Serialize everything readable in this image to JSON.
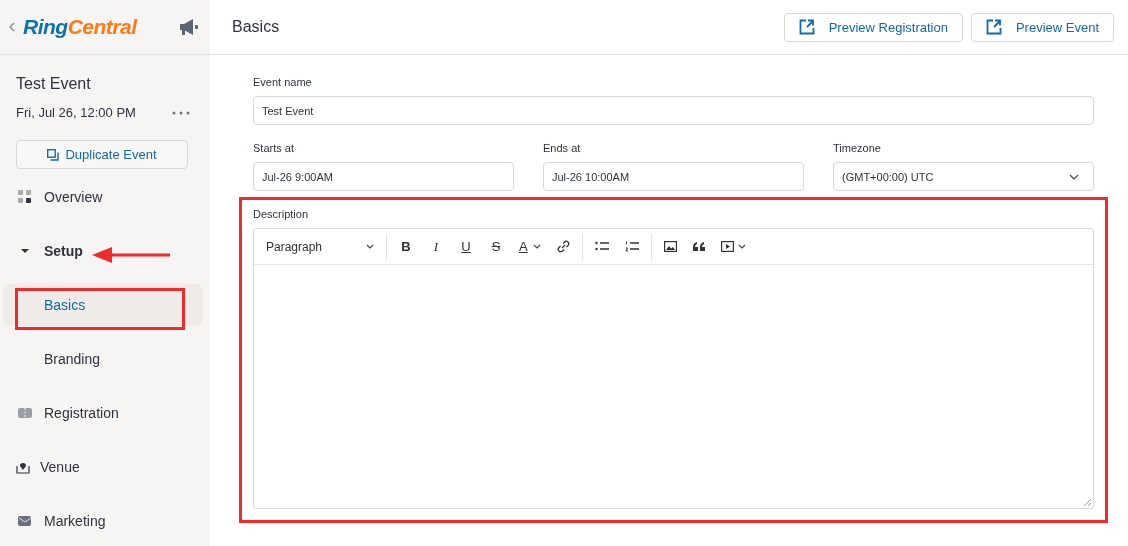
{
  "sidebar": {
    "logo": [
      "Ring",
      "Central"
    ],
    "event": {
      "title": "Test Event",
      "date": "Fri, Jul 26, 12:00 PM"
    },
    "duplicate_button": "Duplicate Event",
    "items": [
      {
        "label": "Overview",
        "kind": "overview",
        "selected": false
      },
      {
        "label": "Setup",
        "kind": "section",
        "expanded": true,
        "pointed": true,
        "selected": false,
        "children": [
          {
            "label": "Basics",
            "selected": true,
            "highlighted": true
          },
          {
            "label": "Branding",
            "selected": false,
            "highlighted": false
          }
        ]
      },
      {
        "label": "Registration",
        "kind": "registration",
        "selected": false
      },
      {
        "label": "Venue",
        "kind": "venue",
        "selected": false
      },
      {
        "label": "Marketing",
        "kind": "marketing",
        "selected": false
      }
    ]
  },
  "header": {
    "title": "Basics",
    "buttons": [
      "Preview Registration",
      "Preview Event"
    ]
  },
  "form": {
    "event_name": {
      "label": "Event name",
      "value": "Test Event"
    },
    "row": [
      {
        "label": "Starts at",
        "value": "Jul-26 9:00AM",
        "kind": "text"
      },
      {
        "label": "Ends at",
        "value": "Jul-26 10:00AM",
        "kind": "text"
      },
      {
        "label": "Timezone",
        "value": "(GMT+00:00) UTC",
        "kind": "select"
      }
    ],
    "description": {
      "label": "Description",
      "highlighted": true,
      "toolbar": [
        {
          "kind": "dropdown",
          "label": "Paragraph"
        },
        {
          "kind": "separator"
        },
        {
          "kind": "bold",
          "glyph": "B"
        },
        {
          "kind": "italic",
          "glyph": "I"
        },
        {
          "kind": "underline",
          "glyph": "U"
        },
        {
          "kind": "strike",
          "glyph": "S"
        },
        {
          "kind": "color",
          "glyph": "A"
        },
        {
          "kind": "link"
        },
        {
          "kind": "separator"
        },
        {
          "kind": "bullets"
        },
        {
          "kind": "numbers"
        },
        {
          "kind": "separator"
        },
        {
          "kind": "image"
        },
        {
          "kind": "quote"
        },
        {
          "kind": "video"
        }
      ]
    }
  }
}
